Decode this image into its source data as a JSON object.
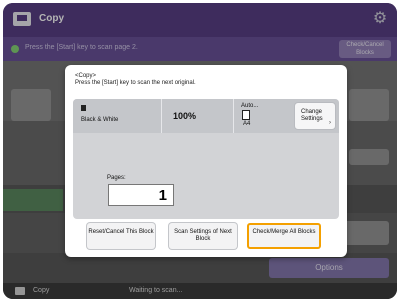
{
  "topbar": {
    "title": "Copy"
  },
  "msgbar": {
    "message": "Press the [Start] key to scan page 2.",
    "check_btn": "Check/Cancel Blocks"
  },
  "background": {
    "options_label": "Options"
  },
  "statusbar": {
    "app": "Copy",
    "status": "Waiting to scan..."
  },
  "dialog": {
    "heading1": "<Copy>",
    "heading2": "Press the [Start] key to scan the next original.",
    "color_mode": "Black & White",
    "zoom": "100%",
    "paper_auto": "Auto...",
    "paper_size": "A4",
    "change_settings": "Change Settings",
    "pages_label": "Pages:",
    "pages_value": "1",
    "buttons": {
      "reset": "Reset/Cancel This Block",
      "scan_settings": "Scan Settings of Next Block",
      "check_merge": "Check/Merge All Blocks"
    }
  },
  "colors": {
    "accent": "#4a2f7a",
    "highlight": "#f4a000"
  }
}
